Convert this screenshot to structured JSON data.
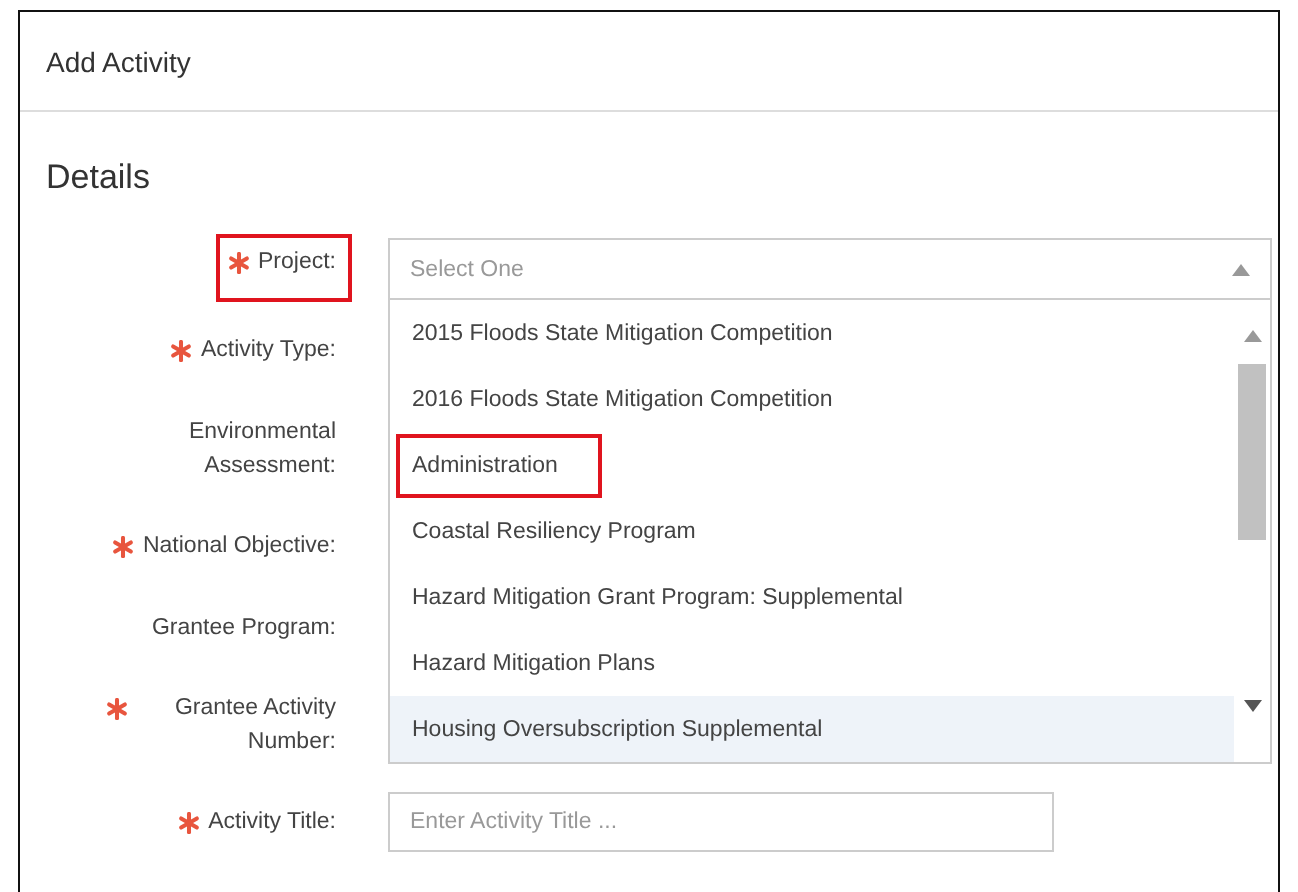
{
  "window": {
    "title": "Add Activity"
  },
  "section": {
    "title": "Details"
  },
  "fields": [
    {
      "label": "Project:",
      "required": true,
      "highlighted": true,
      "kind": "select",
      "placeholder": "Select One",
      "expanded": true,
      "options": [
        {
          "label": "2015 Floods State Mitigation Competition",
          "highlighted": false,
          "hovered": false
        },
        {
          "label": "2016 Floods State Mitigation Competition",
          "highlighted": false,
          "hovered": false
        },
        {
          "label": "Administration",
          "highlighted": true,
          "hovered": false
        },
        {
          "label": "Coastal Resiliency Program",
          "highlighted": false,
          "hovered": false
        },
        {
          "label": "Hazard Mitigation Grant Program: Supplemental",
          "highlighted": false,
          "hovered": false
        },
        {
          "label": "Hazard Mitigation Plans",
          "highlighted": false,
          "hovered": false
        },
        {
          "label": "Housing Oversubscription Supplemental",
          "highlighted": false,
          "hovered": true
        }
      ]
    },
    {
      "label": "Activity Type:",
      "required": true,
      "highlighted": false,
      "kind": "hidden"
    },
    {
      "label": "Environmental Assessment:",
      "required": false,
      "highlighted": false,
      "kind": "hidden"
    },
    {
      "label": "National Objective:",
      "required": true,
      "highlighted": false,
      "kind": "hidden"
    },
    {
      "label": "Grantee Program:",
      "required": false,
      "highlighted": false,
      "kind": "hidden"
    },
    {
      "label": "Grantee Activity Number:",
      "required": true,
      "highlighted": false,
      "kind": "hidden"
    },
    {
      "label": "Activity Title:",
      "required": true,
      "highlighted": false,
      "kind": "text",
      "placeholder": "Enter Activity Title ..."
    }
  ]
}
